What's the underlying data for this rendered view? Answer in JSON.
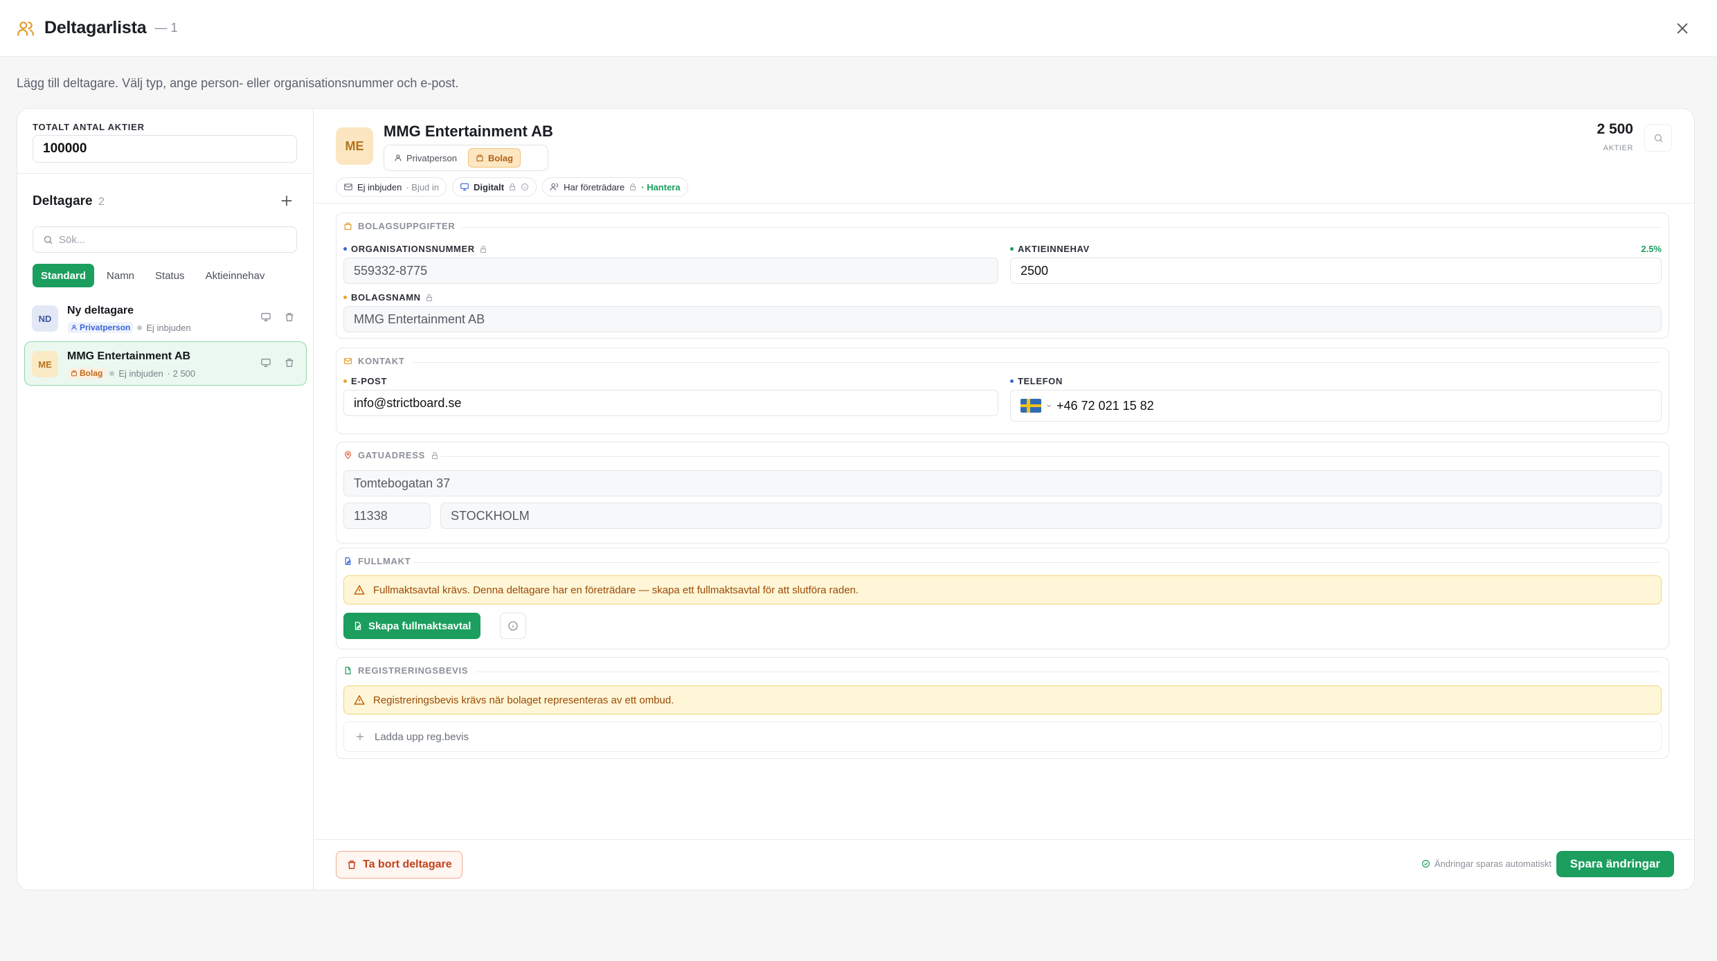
{
  "window": {
    "title": "Deltagarlista",
    "count": "— 1",
    "subtitle": "Lägg till deltagare. Välj typ, ange person- eller organisationsnummer och e-post."
  },
  "sidebar": {
    "total_label": "TOTALT ANTAL AKTIER",
    "total_value": "100000",
    "heading": "Deltagare",
    "count": "2",
    "search_placeholder": "Sök...",
    "sort_tabs": [
      "Standard",
      "Namn",
      "Status",
      "Aktieinnehav"
    ],
    "participants": [
      {
        "initials": "ND",
        "name": "Ny deltagare",
        "type": "Privatperson",
        "status": "Ej inbjuden",
        "shares": ""
      },
      {
        "initials": "ME",
        "name": "MMG Entertainment AB",
        "type": "Bolag",
        "status": "Ej inbjuden",
        "shares": "· 2 500"
      }
    ]
  },
  "detail": {
    "initials": "ME",
    "name": "MMG Entertainment AB",
    "type_options": [
      "Privatperson",
      "Bolag"
    ],
    "shares_value": "2 500",
    "shares_label": "AKTIER",
    "chips": {
      "invite_status": "Ej inbjuden",
      "invite_action": "· Bjud in",
      "channel": "Digitalt",
      "representative": "Har företrädare",
      "representative_action": "· Hantera"
    },
    "company": {
      "title": "BOLAGSUPPGIFTER",
      "org_label": "ORGANISATIONSNUMMER",
      "org_value": "559332-8775",
      "holding_label": "AKTIEINNEHAV",
      "holding_value": "2500",
      "holding_pct": "2.5%",
      "name_label": "BOLAGSNAMN",
      "name_value": "MMG Entertainment AB"
    },
    "contact": {
      "title": "KONTAKT",
      "email_label": "E-POST",
      "email_value": "info@strictboard.se",
      "phone_label": "TELEFON",
      "phone_value": "+46 72 021 15 82"
    },
    "address": {
      "title": "GATUADRESS",
      "street": "Tomtebogatan 37",
      "zip": "11338",
      "city": "STOCKHOLM"
    },
    "poa": {
      "title": "FULLMAKT",
      "alert": "Fullmaktsavtal krävs. Denna deltagare har en företrädare — skapa ett fullmaktsavtal för att slutföra raden.",
      "create_button": "Skapa fullmaktsavtal"
    },
    "registration": {
      "title": "REGISTRERINGSBEVIS",
      "alert": "Registreringsbevis krävs när bolaget representeras av ett ombud.",
      "upload": "Ladda upp reg.bevis"
    },
    "footer": {
      "remove": "Ta bort deltagare",
      "autosave": "Ändringar sparas automatiskt",
      "save": "Spara ändringar"
    }
  },
  "colors": {
    "accent_green": "#1b9e5e",
    "warning_bg": "#fef6d6",
    "warning_text": "#9b4a07",
    "danger": "#c2431c",
    "company_orange": "#b6721a"
  },
  "icons": [
    "users-icon",
    "close-icon",
    "plus-icon",
    "search-icon",
    "monitor-icon",
    "trash-icon",
    "person-icon",
    "building-icon",
    "mail-icon",
    "lock-icon",
    "info-icon",
    "map-pin-icon",
    "file-edit-icon",
    "file-icon",
    "warning-icon",
    "check-circle-icon",
    "sweden-flag-icon"
  ]
}
